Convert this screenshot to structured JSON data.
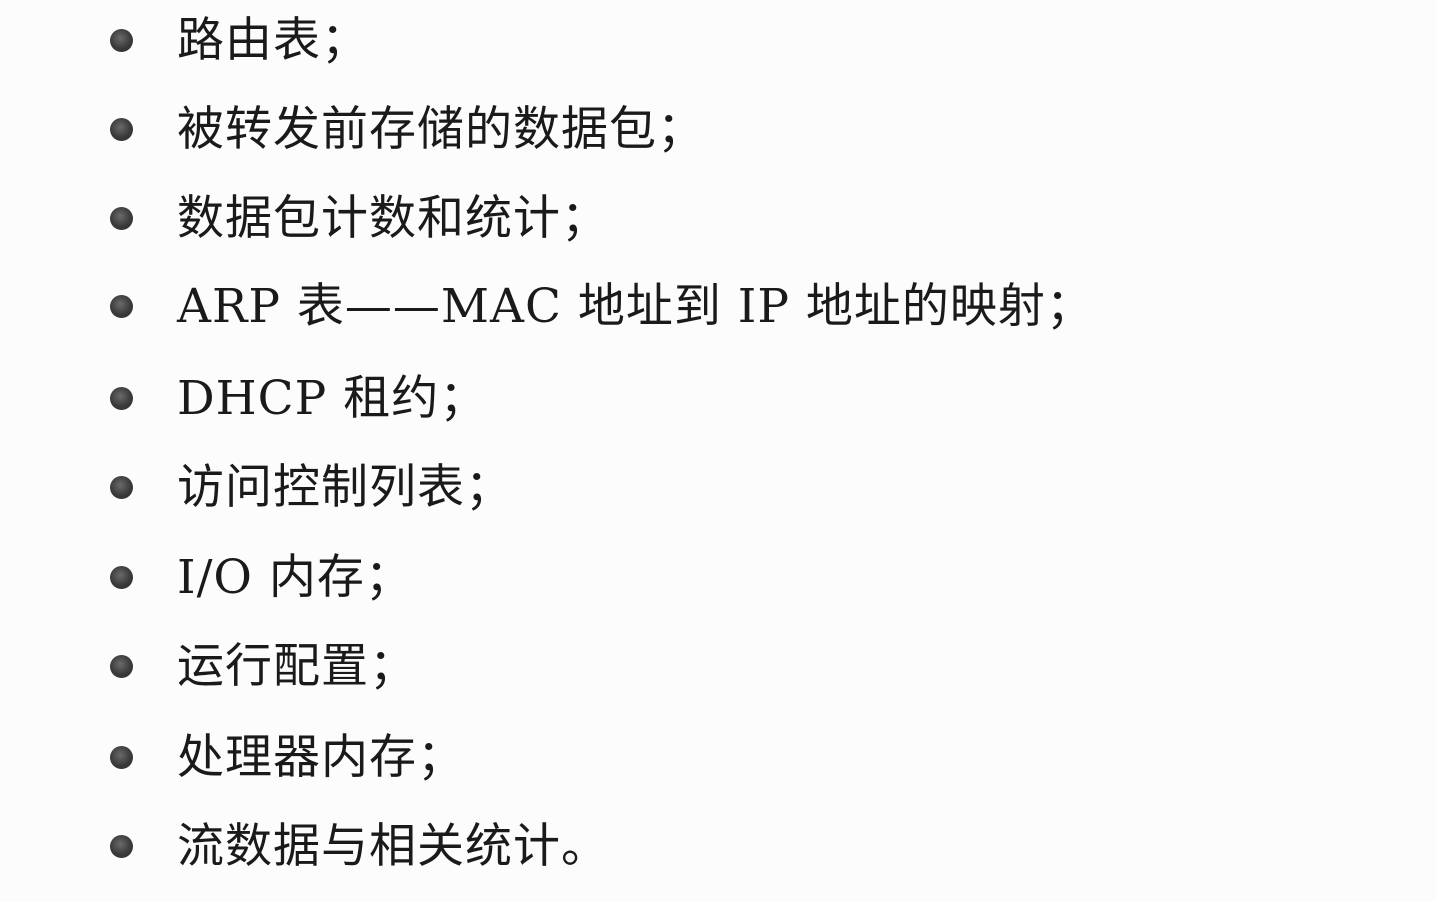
{
  "list": {
    "items": [
      {
        "text": "路由表；"
      },
      {
        "text": "被转发前存储的数据包；"
      },
      {
        "text": "数据包计数和统计；"
      },
      {
        "text": "ARP 表——MAC 地址到 IP 地址的映射；"
      },
      {
        "text": "DHCP 租约；"
      },
      {
        "text": "访问控制列表；"
      },
      {
        "text": "I/O 内存；"
      },
      {
        "text": "运行配置；"
      },
      {
        "text": "处理器内存；"
      },
      {
        "text": "流数据与相关统计。"
      }
    ]
  }
}
